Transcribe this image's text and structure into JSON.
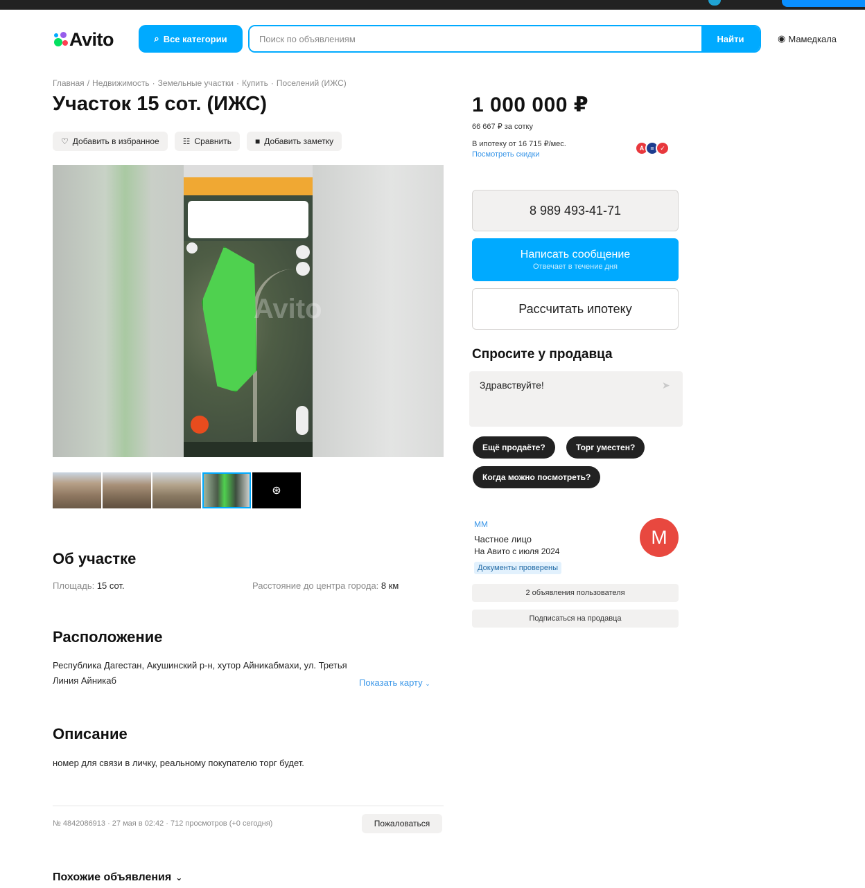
{
  "header": {
    "logo_text": "Avito",
    "categories_label": "Все категории",
    "search_placeholder": "Поиск по объявлениям",
    "search_value": "",
    "find_label": "Найти",
    "location": "Мамедкала"
  },
  "breadcrumbs": [
    "Главная",
    "Недвижимость",
    "Земельные участки",
    "Купить",
    "Поселений (ИЖС)"
  ],
  "breadcrumb_separator": "·",
  "listing": {
    "title": "Участок 15 сот. (ИЖС)",
    "actions": {
      "favorite": "Добавить в избранное",
      "compare": "Сравнить",
      "note": "Добавить заметку"
    },
    "watermark": "Avito"
  },
  "about": {
    "heading": "Об участке",
    "area_label": "Площадь:",
    "area_value": "15 сот.",
    "distance_label": "Расстояние до центра города:",
    "distance_value": "8 км"
  },
  "location_section": {
    "heading": "Расположение",
    "address": "Республика Дагестан, Акушинский р-н, хутор Айникабмахи, ул. Третья Линия Айникаб",
    "show_map": "Показать карту"
  },
  "description": {
    "heading": "Описание",
    "text": "номер для связи в личку, реальному покупателю торг будет."
  },
  "meta": {
    "info": "№ 4842086913 · 27 мая в 02:42 · 712 просмотров (+0 сегодня)",
    "report": "Пожаловаться"
  },
  "similar": "Похожие объявления",
  "price": {
    "value": "1 000 000 ₽",
    "per_sotka": "66 667 ₽ за сотку",
    "mortgage": "В ипотеку от 16 715 ₽/мес.",
    "discounts": "Посмотреть скидки"
  },
  "contact": {
    "phone": "8 989 493-41-71",
    "message": "Написать сообщение",
    "message_sub": "Отвечает в течение дня",
    "calc": "Рассчитать ипотеку"
  },
  "ask": {
    "heading": "Спросите у продавца",
    "message": "Здравствуйте!",
    "chips": [
      "Ещё продаёте?",
      "Торг уместен?",
      "Когда можно посмотреть?"
    ]
  },
  "seller": {
    "name": "ММ",
    "type": "Частное лицо",
    "since": "На Авито с июля 2024",
    "verified": "Документы проверены",
    "avatar_letter": "M",
    "listings": "2 объявления пользователя",
    "subscribe": "Подписаться на продавца"
  },
  "colors": {
    "accent": "#00aaff",
    "link": "#3996e8",
    "avatar": "#e8483f",
    "chip": "#222222"
  },
  "icons": [
    "search-icon",
    "heart-icon",
    "compare-icon",
    "note-icon",
    "location-pin-icon",
    "send-icon",
    "chevron-down-icon",
    "camera-icon"
  ]
}
